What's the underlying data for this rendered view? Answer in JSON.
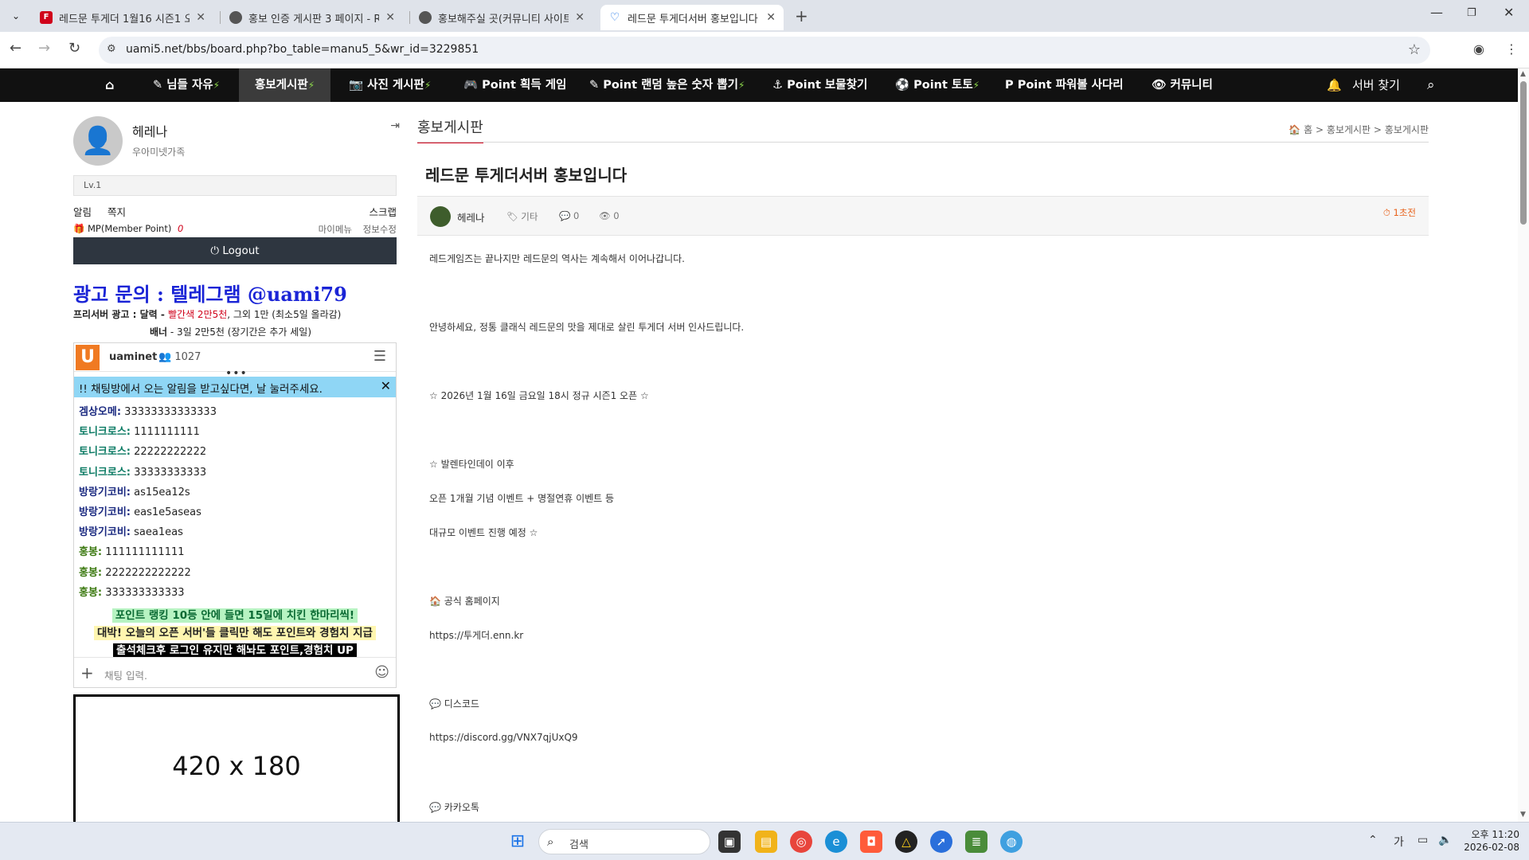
{
  "browser": {
    "tabs": [
      {
        "title": "레드문 투게더 1월16 시즌1 오",
        "icon_color": "#d0021b",
        "icon_letter": "F"
      },
      {
        "title": "홍보 인증 게시판 3 페이지 - R",
        "icon_color": "#555555",
        "icon_letter": ""
      },
      {
        "title": "홍보해주실 곳(커뮤니티 사이트",
        "icon_color": "#555555",
        "icon_letter": ""
      },
      {
        "title": "레드문 투게더서버 홍보입니다",
        "icon_color": "#1a73e8",
        "icon_letter": ""
      }
    ],
    "url": "uami5.net/bbs/board.php?bo_table=manu5_5&wr_id=3229851"
  },
  "nav": {
    "items": [
      {
        "label": "님들 자유",
        "icon": "✎",
        "bolt": true,
        "active": false
      },
      {
        "label": "홍보게시판",
        "icon": "",
        "bolt": true,
        "active": true
      },
      {
        "label": "사진 게시판",
        "icon": "📷",
        "bolt": true,
        "active": false
      },
      {
        "label": "Point 획득 게임",
        "icon": "🎮",
        "bolt": false,
        "active": false
      },
      {
        "label": "Point 랜덤 높은 숫자 뽑기",
        "icon": "✎",
        "bolt": true,
        "active": false
      },
      {
        "label": "Point 보물찾기",
        "icon": "⚓",
        "bolt": false,
        "active": false
      },
      {
        "label": "Point 토토",
        "icon": "⚽",
        "bolt": true,
        "active": false
      },
      {
        "label": "Point 파워볼 사다리",
        "icon": "P",
        "bolt": false,
        "active": false
      },
      {
        "label": "커뮤니티",
        "icon": "👁",
        "bolt": false,
        "active": false
      }
    ],
    "server_find": "서버 찾기"
  },
  "sidebar": {
    "user_name": "헤레나",
    "user_group": "우아미넷가족",
    "level": "Lv.1",
    "link_alert": "알림",
    "link_note": "쪽지",
    "link_scrap": "스크랩",
    "mp_label": "MP(Member Point)",
    "mp_value": "0",
    "link_mymenu": "마이메뉴",
    "link_edit": "정보수정",
    "logout": "Logout"
  },
  "ad": {
    "title": "광고 문의 :  텔레그램 @uami79",
    "line1_a": "프리서버 광고 : 달력 - ",
    "line1_red": "빨간색 2만5천",
    "line1_b": ", 그외 1만 (최소5일 올라감)",
    "line2_a": "배너",
    "line2_b": " - 3일 2만5천 (장기간은 추가 세일)"
  },
  "chat": {
    "name": "uaminet",
    "users": "1027",
    "notice": "!! 채팅방에서 오는 알림을 받고싶다면, 날 눌러주세요.",
    "messages": [
      {
        "who": "겜상오메:",
        "text": " 33333333333333",
        "color": "#1b2a80"
      },
      {
        "who": "토니크로스:",
        "text": " 1111111111",
        "color": "#0a7a63"
      },
      {
        "who": "토니크로스:",
        "text": " 22222222222",
        "color": "#0a7a63"
      },
      {
        "who": "토니크로스:",
        "text": " 33333333333",
        "color": "#0a7a63"
      },
      {
        "who": "방랑기코비:",
        "text": " as15ea12s",
        "color": "#1b2a80"
      },
      {
        "who": "방랑기코비:",
        "text": " eas1e5aseas",
        "color": "#1b2a80"
      },
      {
        "who": "방랑기코비:",
        "text": " saea1eas",
        "color": "#1b2a80"
      },
      {
        "who": "홍봉:",
        "text": " 111111111111",
        "color": "#3d7a12"
      },
      {
        "who": "홍봉:",
        "text": " 2222222222222",
        "color": "#3d7a12"
      },
      {
        "who": "홍봉:",
        "text": " 333333333333",
        "color": "#3d7a12"
      }
    ],
    "promo1": "포인트 랭킹 10등 안에 들면 15일에 치킨 한마리씩!",
    "promo2": "대박! 오늘의 오픈 서버'들 클릭만 해도 포인트와 경험치 지급",
    "promo3": "출석체크후 로그인 유지만 해놔도 포인트,경험치 UP",
    "input_placeholder": "채팅 입력."
  },
  "banner": {
    "text": "420 x 180"
  },
  "board": {
    "title": "홍보게시판",
    "crumbs": "🏠 홈 > 홍보게시판 > 홍보게시판",
    "post_title": "레드문 투게더서버 홍보입니다",
    "author": "헤레나",
    "category": "기타",
    "comments": "0",
    "views": "0",
    "time": "1초전",
    "body": [
      "레드게임즈는 끝나지만 레드문의 역사는 계속해서 이어나갑니다.",
      "안녕하세요, 정통 클래식 레드문의 맛을 제대로 살린 투게더 서버 인사드립니다.",
      "☆ 2026년 1월 16일 금요일 18시 정규 시즌1 오픈 ☆",
      "☆ 발렌타인데이 이후",
      "오픈 1개월 기념 이벤트 + 명절연휴 이벤트 등",
      "대규모 이벤트 진행 예정 ☆",
      "🏠 공식 홈페이지",
      "https://투게더.enn.kr",
      "💬 디스코드",
      "https://discord.gg/VNX7qjUxQ9",
      "💬 카카오톡"
    ]
  },
  "taskbar": {
    "search": "검색",
    "ime": "가",
    "time": "오후 11:20",
    "date": "2026-02-08"
  },
  "colors": {
    "nav_bg": "#111111",
    "accent_red": "#d0021b",
    "chat_notice": "#8fd6f5",
    "ad_blue": "#1a24d6"
  }
}
